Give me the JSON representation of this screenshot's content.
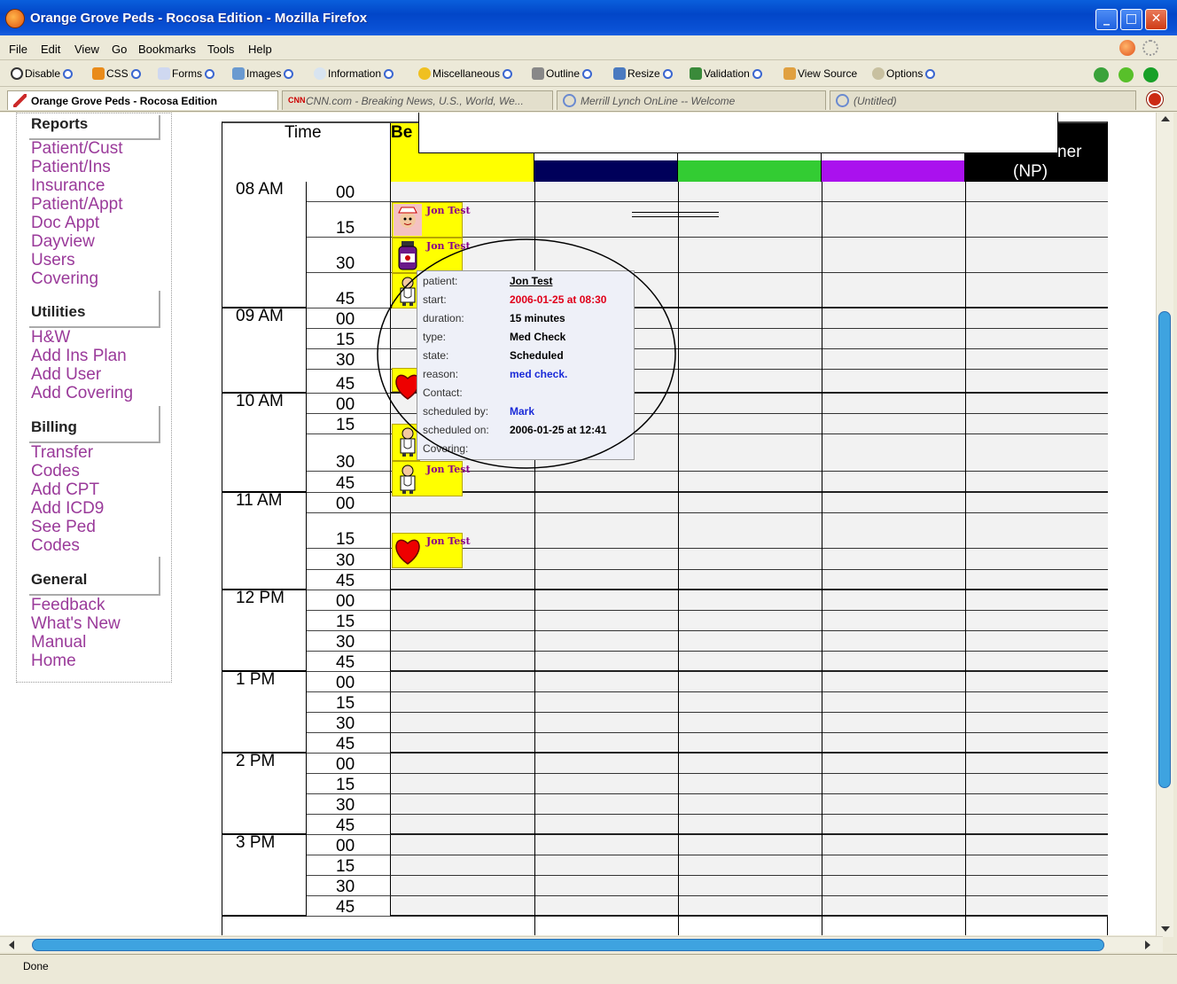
{
  "window": {
    "title": "Orange Grove Peds - Rocosa Edition - Mozilla Firefox",
    "minimize": "_",
    "maximize": "□",
    "close": "✕",
    "title_icon": "firefox-icon"
  },
  "menu": [
    "File",
    "Edit",
    "View",
    "Go",
    "Bookmarks",
    "Tools",
    "Help"
  ],
  "toolbar": [
    "Disable",
    "CSS",
    "Forms",
    "Images",
    "Information",
    "Miscellaneous",
    "Outline",
    "Resize",
    "Validation",
    "View Source",
    "Options"
  ],
  "tabs": [
    {
      "label": "Orange Grove Peds - Rocosa Edition",
      "active": true
    },
    {
      "label": "CNN.com - Breaking News, U.S., World, We...",
      "icon_text": "CNN"
    },
    {
      "label": "Merrill Lynch OnLine -- Welcome"
    },
    {
      "label": "(Untitled)"
    }
  ],
  "sidebar": {
    "sections": [
      {
        "title": "Reports",
        "links": [
          "Patient/Cust",
          "Patient/Ins",
          "Insurance",
          "Patient/Appt",
          "Doc Appt",
          "Dayview",
          "Users",
          "Covering"
        ]
      },
      {
        "title": "Utilities",
        "links": [
          "H&W",
          "Add Ins Plan",
          "Add User",
          "Add Covering"
        ]
      },
      {
        "title": "Billing",
        "links": [
          "Transfer",
          "Codes",
          "Add CPT",
          "Add ICD9",
          "See Ped",
          "Codes"
        ]
      },
      {
        "title": "General",
        "links": [
          "Feedback",
          "What's New",
          "Manual",
          "Home"
        ]
      }
    ]
  },
  "schedule": {
    "time_header": "Time",
    "col1_header": "Be",
    "col5_header_top": ":",
    "col5_header_mid": "ner",
    "col5_header_bottom": "(NP)",
    "column_colors": [
      "#ffff00",
      "#00005a",
      "#33cc33",
      "#aa11ee",
      "#000000"
    ],
    "hours": [
      "08 AM",
      "09 AM",
      "10 AM",
      "11 AM",
      "12 PM",
      "1 PM",
      "2 PM",
      "3 PM"
    ],
    "minutes": [
      "00",
      "15",
      "30",
      "45"
    ],
    "appointments": [
      {
        "time": "08:15",
        "name": "Jon Test",
        "icon": "nurse-icon"
      },
      {
        "time": "08:30",
        "name": "Jon Test",
        "icon": "medicine-bottle-icon"
      },
      {
        "time": "08:45",
        "name": "Jon Test",
        "icon": "doctor-icon"
      },
      {
        "time": "09:45",
        "name": "Jon Test",
        "icon": "heart-icon"
      },
      {
        "time": "10:15",
        "name": "Jon Test",
        "icon": "doctor-icon"
      },
      {
        "time": "10:30",
        "name": "Jon Test",
        "icon": "doctor-icon"
      },
      {
        "time": "11:15",
        "name": "Jon Test",
        "icon": "heart-icon"
      }
    ]
  },
  "tooltip": {
    "patient_label": "patient:",
    "patient": "Jon Test",
    "start_label": "start:",
    "start": "2006-01-25 at 08:30",
    "duration_label": "duration:",
    "duration": "15 minutes",
    "type_label": "type:",
    "type": "Med Check",
    "state_label": "state:",
    "state": "Scheduled",
    "reason_label": "reason:",
    "reason": "med check.",
    "contact_label": "Contact:",
    "scheduled_by_label": "scheduled by:",
    "scheduled_by": "Mark",
    "scheduled_on_label": "scheduled on:",
    "scheduled_on": "2006-01-25 at 12:41",
    "covering_label": "Covering:"
  },
  "status": "Done"
}
